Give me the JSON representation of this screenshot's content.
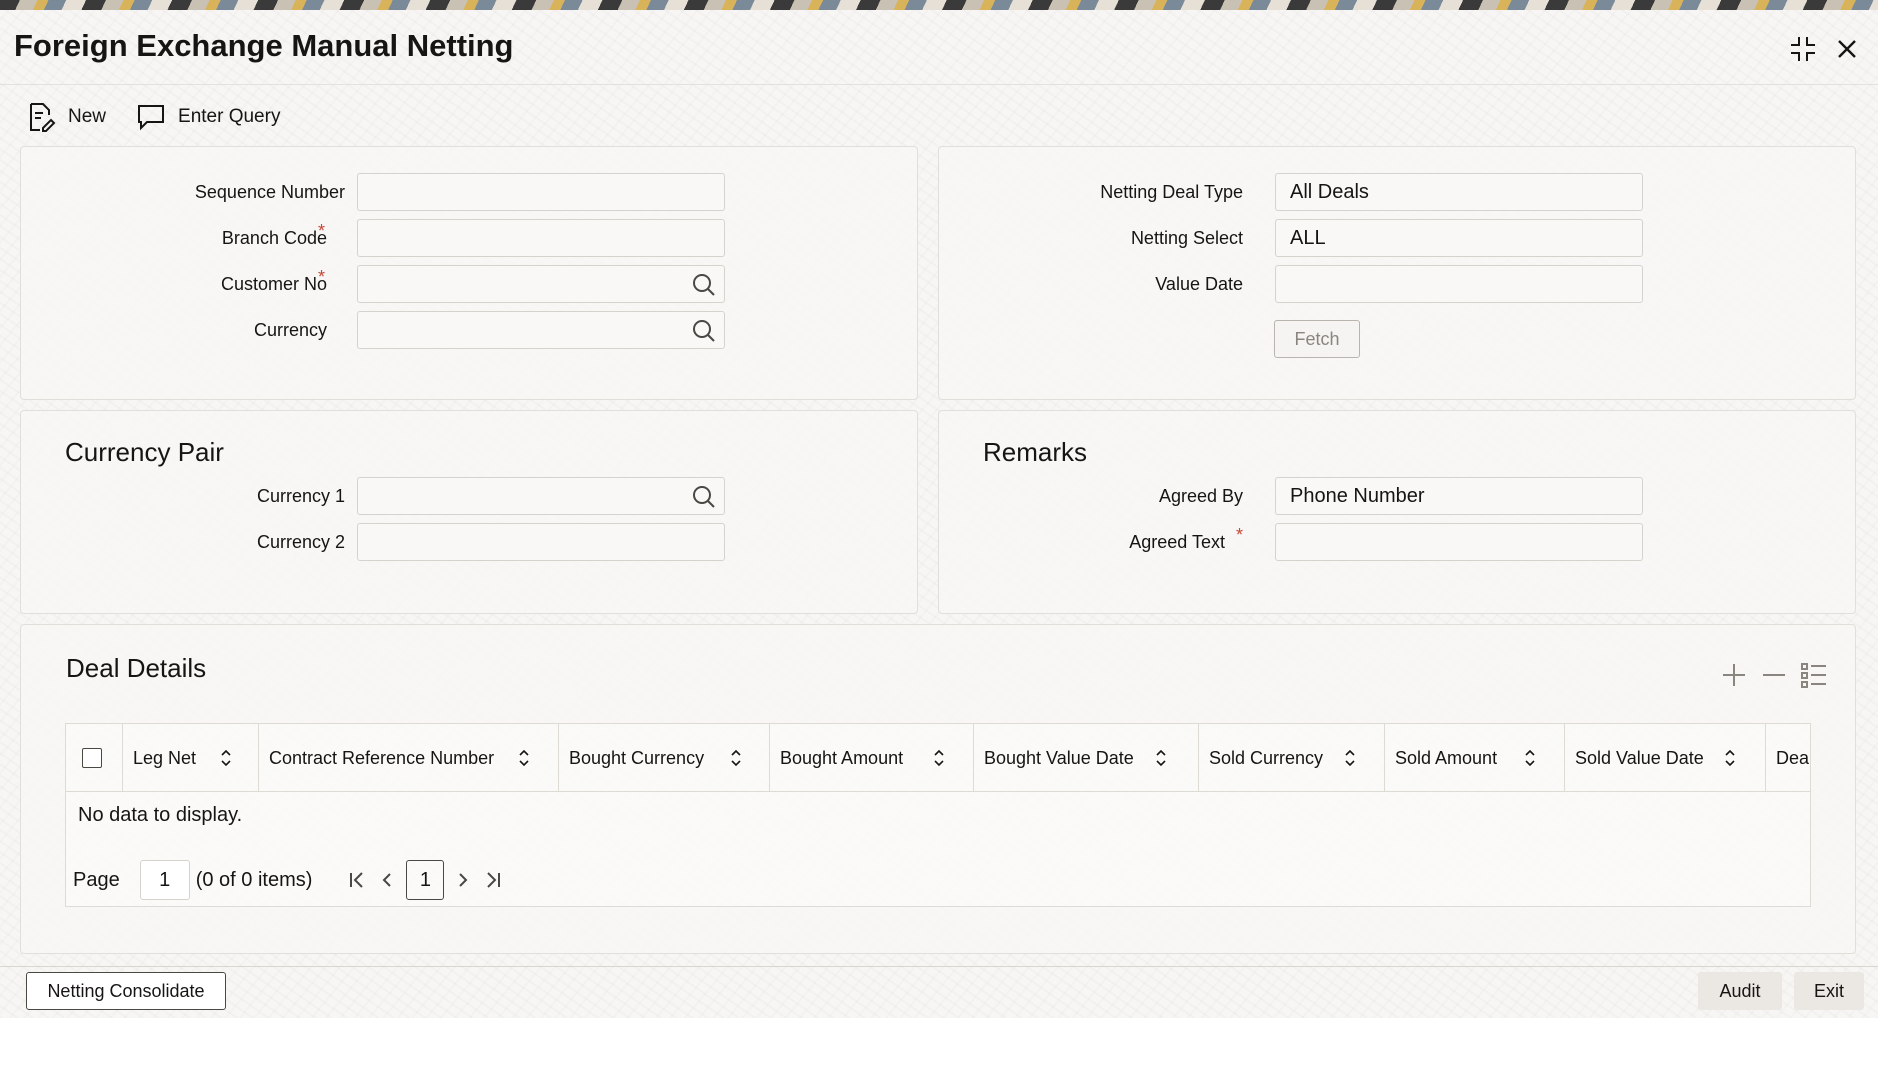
{
  "window": {
    "title": "Foreign Exchange Manual Netting",
    "minimize_icon": "compress-icon",
    "close_icon": "close-icon"
  },
  "toolbar": {
    "new_label": "New",
    "enter_query_label": "Enter Query"
  },
  "main_form": {
    "sequence_number": {
      "label": "Sequence Number",
      "value": ""
    },
    "branch_code": {
      "label": "Branch Code",
      "required": "*",
      "value": ""
    },
    "customer_no": {
      "label": "Customer No",
      "required": "*",
      "value": ""
    },
    "currency": {
      "label": "Currency",
      "value": ""
    },
    "netting_deal_type": {
      "label": "Netting Deal Type",
      "value": "All Deals"
    },
    "netting_select": {
      "label": "Netting Select",
      "value": "ALL"
    },
    "value_date": {
      "label": "Value Date",
      "value": ""
    },
    "fetch_label": "Fetch"
  },
  "currency_pair": {
    "title": "Currency Pair",
    "currency1": {
      "label": "Currency 1",
      "value": ""
    },
    "currency2": {
      "label": "Currency 2",
      "value": ""
    }
  },
  "remarks": {
    "title": "Remarks",
    "agreed_by": {
      "label": "Agreed By",
      "value": "Phone Number"
    },
    "agreed_text": {
      "label": "Agreed Text",
      "required": "*",
      "value": ""
    }
  },
  "deal_details": {
    "title": "Deal Details",
    "columns": [
      "Leg Net",
      "Contract Reference Number",
      "Bought Currency",
      "Bought Amount",
      "Bought Value Date",
      "Sold Currency",
      "Sold Amount",
      "Sold Value Date",
      "Deal"
    ],
    "rows": [],
    "empty_message": "No data to display.",
    "pager": {
      "page_label": "Page",
      "page_value": "1",
      "items_text": "(0 of 0 items)",
      "current_page": "1"
    }
  },
  "footer": {
    "netting_consolidate_label": "Netting Consolidate",
    "audit_label": "Audit",
    "exit_label": "Exit"
  },
  "colors": {
    "required": "#c74634",
    "text": "#161513",
    "disabled_text": "#8a867f"
  }
}
